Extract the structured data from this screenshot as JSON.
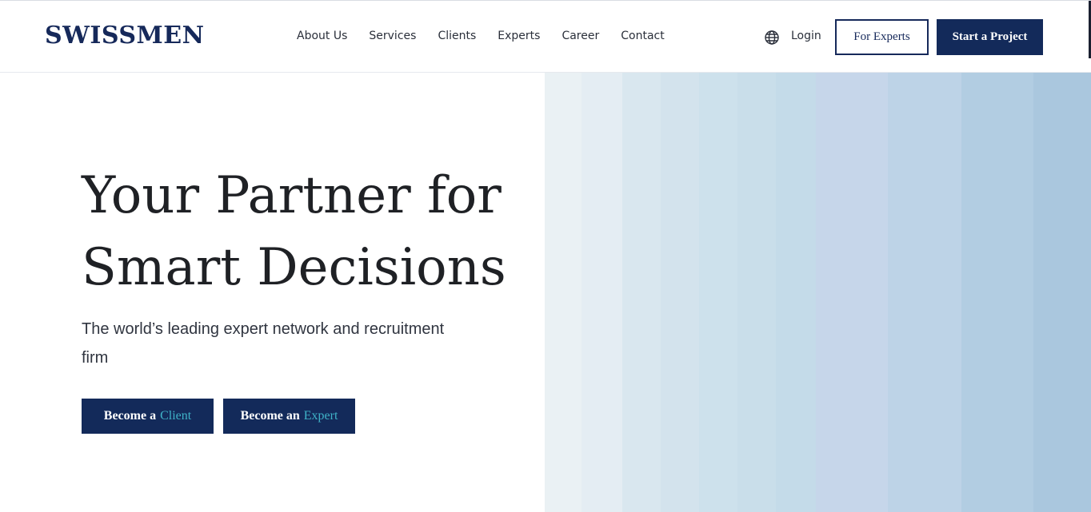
{
  "header": {
    "logo": "SWISSMEN",
    "nav": [
      {
        "label": "About Us"
      },
      {
        "label": "Services"
      },
      {
        "label": "Clients"
      },
      {
        "label": "Experts"
      },
      {
        "label": "Career"
      },
      {
        "label": "Contact"
      }
    ],
    "language_icon": "globe-icon",
    "login_label": "Login",
    "for_experts_label": "For Experts",
    "start_project_label": "Start a Project"
  },
  "hero": {
    "title_line1": "Your Partner for",
    "title_line2": "Smart Decisions",
    "subtitle": "The world’s leading expert network and recruitment firm",
    "buttons": [
      {
        "prefix": "Become a",
        "accent": "Client"
      },
      {
        "prefix": "Become an",
        "accent": "Expert"
      }
    ]
  },
  "colors": {
    "brand_navy": "#132a5a",
    "accent_teal": "#3fb3c8",
    "stripe_palette": [
      "#eaf1f4",
      "#e4edf3",
      "#d9e7ef",
      "#d3e3ed",
      "#cde1ec",
      "#c9deea",
      "#c4dbe9",
      "#c6d6ea",
      "#bdd3e7",
      "#b2cde2",
      "#aac7de"
    ]
  }
}
